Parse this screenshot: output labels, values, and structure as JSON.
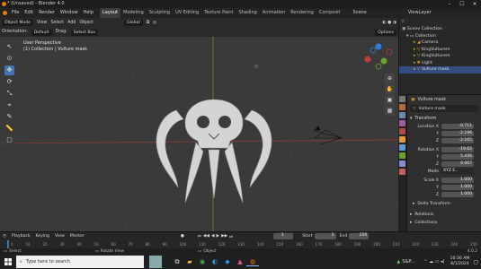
{
  "window": {
    "title": "* (Unsaved) - Blender 4.0",
    "controls": [
      "minimize-icon",
      "maximize-icon",
      "close-icon"
    ]
  },
  "menu": {
    "items": [
      "File",
      "Edit",
      "Render",
      "Window",
      "Help"
    ],
    "workspaces": [
      "Layout",
      "Modeling",
      "Sculpting",
      "UV Editing",
      "Texture Paint",
      "Shading",
      "Animation",
      "Rendering",
      "Composit"
    ],
    "active_workspace": "Layout",
    "scene_label": "Scene",
    "viewlayer_label": "ViewLayer"
  },
  "viewport_header": {
    "mode": "Object Mode",
    "menus": [
      "View",
      "Select",
      "Add",
      "Object"
    ],
    "transform_orientation": "Global",
    "orientation_label": "Orientation:",
    "orientation_value": "Default",
    "drag_label": "Drag:",
    "drag_value": "Select Box",
    "options_label": "Options"
  },
  "viewport": {
    "perspective_text": "User Perspective",
    "collection_text": "(1) Collection | Vulture mask"
  },
  "outliner": {
    "rows": [
      {
        "label": "Scene Collection",
        "indent": 0
      },
      {
        "label": "Collection",
        "indent": 1
      },
      {
        "label": "Camera",
        "indent": 2
      },
      {
        "label": "KingVulturem",
        "indent": 2
      },
      {
        "label": "KingVulturem",
        "indent": 2
      },
      {
        "label": "Light",
        "indent": 2
      },
      {
        "label": "Vulture mask",
        "indent": 2
      }
    ]
  },
  "properties": {
    "object_name": "Vulture mask",
    "object_sub": "Vulture mask",
    "transform_label": "Transform",
    "location_label": "Location X",
    "location": [
      "-0.711",
      "-2.196",
      "-2.165"
    ],
    "rotation_label": "Rotation X",
    "rotation": [
      "-19.62",
      "5.436",
      "0.067"
    ],
    "mode_label": "Mode",
    "mode_value": "XYZ E..",
    "scale_label": "Scale X",
    "scale": [
      "1.000",
      "1.000",
      "1.000"
    ],
    "axis_y": "Y",
    "axis_z": "Z",
    "delta_label": "Delta Transform",
    "relations_label": "Relations",
    "collections_label": "Collections"
  },
  "timeline": {
    "menus": [
      "Playback",
      "Keying",
      "View",
      "Marker"
    ],
    "current_frame": "1",
    "start_label": "Start",
    "start_value": "1",
    "end_label": "End",
    "end_value": "250",
    "ticks": [
      "0",
      "10",
      "20",
      "30",
      "40",
      "50",
      "60",
      "70",
      "80",
      "90",
      "100",
      "110",
      "120",
      "130",
      "140",
      "150",
      "160",
      "170",
      "180",
      "190",
      "200",
      "210",
      "220",
      "230",
      "240",
      "250"
    ]
  },
  "statusbar": {
    "select": "Select",
    "rotate": "Rotate View",
    "object": "Object",
    "version": "4.0.2"
  },
  "taskbar": {
    "search_placeholder": "Type here to search",
    "stock": "S&P...",
    "time": "10:36 AM",
    "date": "8/1/2024"
  }
}
